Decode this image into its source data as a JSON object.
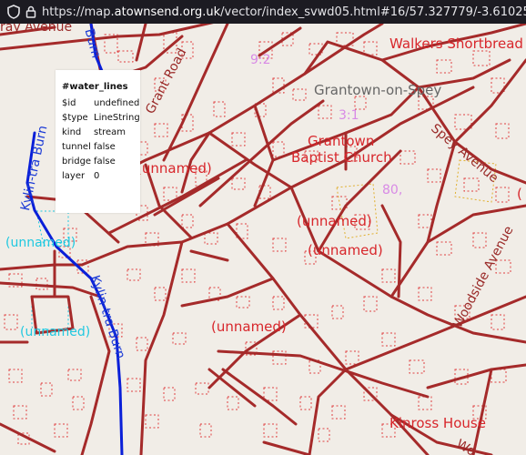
{
  "browser": {
    "url_prefix": "https://map.",
    "url_domain": "atownsend.org.uk",
    "url_rest": "/vector/index_svwd05.html#16/57.327779/-3.610257"
  },
  "popup": {
    "title": "#water_lines",
    "rows": [
      {
        "key": "$id",
        "value": "undefined"
      },
      {
        "key": "$type",
        "value": "LineString"
      },
      {
        "key": "kind",
        "value": "stream"
      },
      {
        "key": "tunnel",
        "value": "false"
      },
      {
        "key": "bridge",
        "value": "false"
      },
      {
        "key": "layer",
        "value": "0"
      }
    ]
  },
  "labels": {
    "walkers": "Walkers Shortbread",
    "grantown": "Grantown-on-Spey",
    "church1": "Grantown",
    "church2": "Baptist Church",
    "unnamed1": "(unnamed)",
    "unnamed2": "(unnamed)",
    "unnamed3": "(unnamed)",
    "unnamed4": "(unnamed)",
    "unnamed_cyan1": "(unnamed)",
    "unnamed_cyan2": "(unnamed)",
    "kinross": "Kinross House",
    "grant_road": "Grant Road",
    "spey_avenue": "Spey Avenue",
    "woodside": "Woodside Avenue",
    "ray_avenue": "ray Avenue",
    "burn_top": "Burn",
    "kylintra1": "Kylin-tra Burn",
    "kylintra2": "Kylin-tra Burn",
    "pink1": "9:2",
    "pink2": "3:1",
    "pink3": "80,",
    "edge_paren": "(",
    "edge_wo": "Wo"
  },
  "colors": {
    "road": "#a52a2a",
    "building": "#e04040",
    "stream": "#0a1fd8",
    "background": "#f1ede7"
  }
}
